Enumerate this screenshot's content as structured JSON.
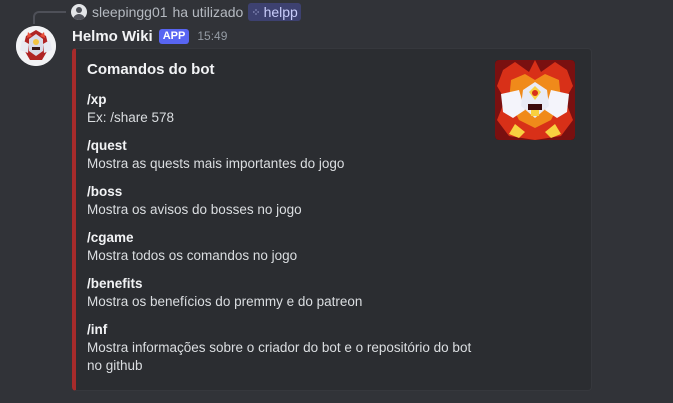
{
  "reply": {
    "username": "sleepingg01",
    "used_text": "ha utilizado",
    "command": "helpp"
  },
  "message": {
    "author": "Helmo Wiki",
    "badge": "APP",
    "time": "15:49"
  },
  "embed": {
    "accent_color": "#a62b2b",
    "title": "Comandos do bot",
    "fields": [
      {
        "name": "/xp",
        "value": "Ex: /share 578"
      },
      {
        "name": "/quest",
        "value": "Mostra as quests mais importantes do jogo"
      },
      {
        "name": "/boss",
        "value": "Mostra os avisos do bosses no jogo"
      },
      {
        "name": "/cgame",
        "value": "Mostra todos os comandos no jogo"
      },
      {
        "name": "/benefits",
        "value": "Mostra os benefícios do premmy e do patreon"
      },
      {
        "name": "/inf",
        "value": "Mostra informações sobre o criador do bot e o repositório do bot no github"
      }
    ]
  }
}
